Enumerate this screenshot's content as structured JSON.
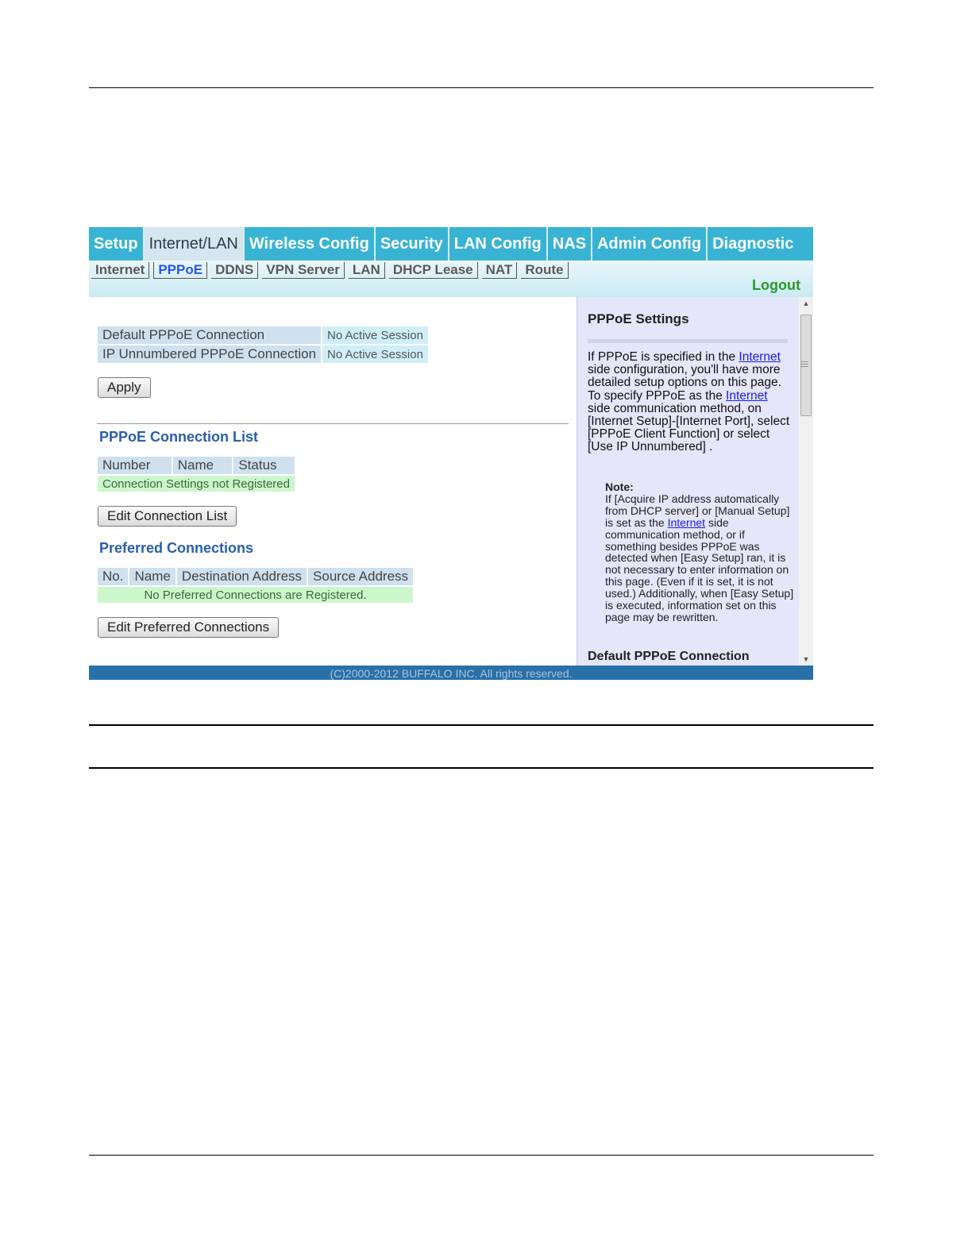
{
  "topnav": [
    "Setup",
    "Internet/LAN",
    "Wireless Config",
    "Security",
    "LAN Config",
    "NAS",
    "Admin Config",
    "Diagnostic"
  ],
  "subnav": [
    "Internet",
    "PPPoE",
    "DDNS",
    "VPN Server",
    "LAN",
    "DHCP Lease",
    "NAT",
    "Route"
  ],
  "logout": "Logout",
  "status": {
    "default_label": "Default PPPoE Connection",
    "default_value": "No Active Session",
    "unnumbered_label": "IP Unnumbered PPPoE Connection",
    "unnumbered_value": "No Active Session"
  },
  "apply": "Apply",
  "conn_list": {
    "title": "PPPoE Connection List",
    "headers": [
      "Number",
      "Name",
      "Status"
    ],
    "empty": "Connection Settings not Registered",
    "button": "Edit Connection List"
  },
  "preferred": {
    "title": "Preferred Connections",
    "headers": [
      "No.",
      "Name",
      "Destination Address",
      "Source Address"
    ],
    "empty": "No Preferred Connections are Registered.",
    "button": "Edit Preferred Connections"
  },
  "help": {
    "title": "PPPoE Settings",
    "p1_a": "If PPPoE is specified in the",
    "link": "Internet",
    "p1_b": "side configuration, you'll have more detailed setup options on this page. To specify PPPoE as the",
    "p1_c": "side communication method, on [Internet Setup]-[Internet Port], select [PPPoE Client Function] or select [Use IP Unnumbered] .",
    "note_title": "Note:",
    "note_a": "If [Acquire IP address automatically from DHCP server] or [Manual Setup] is set as the",
    "note_b": "side communication method, or if something besides PPPoE was detected when [Easy Setup] ran, it is not necessary to enter information on this page. (Even if it is set, it is not used.) Additionally, when [Easy Setup] is executed, information set on this page may be rewritten.",
    "footer_heading": "Default PPPoE Connection"
  },
  "footer": "(C)2000-2012 BUFFALO INC. All rights reserved."
}
